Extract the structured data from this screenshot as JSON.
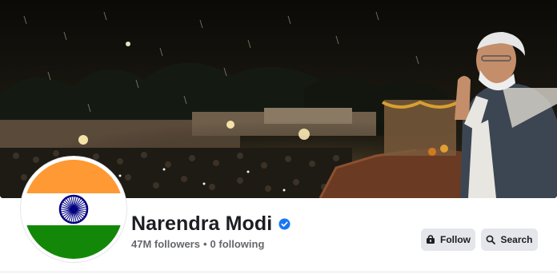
{
  "profile": {
    "name": "Narendra Modi",
    "followers": "47M followers",
    "separator": "•",
    "following": "0 following",
    "verified": true
  },
  "actions": {
    "follow_label": "Follow",
    "search_label": "Search"
  },
  "icons": {
    "verified": "verified-badge-icon",
    "follow": "follow-user-icon",
    "search": "search-icon"
  },
  "colors": {
    "verified_blue": "#1877f2",
    "button_bg": "#e4e6eb",
    "name_text": "#1c1e21",
    "meta_text": "#65676b",
    "flag_saffron": "#ff9933",
    "flag_green": "#138808",
    "chakra_navy": "#000080"
  }
}
